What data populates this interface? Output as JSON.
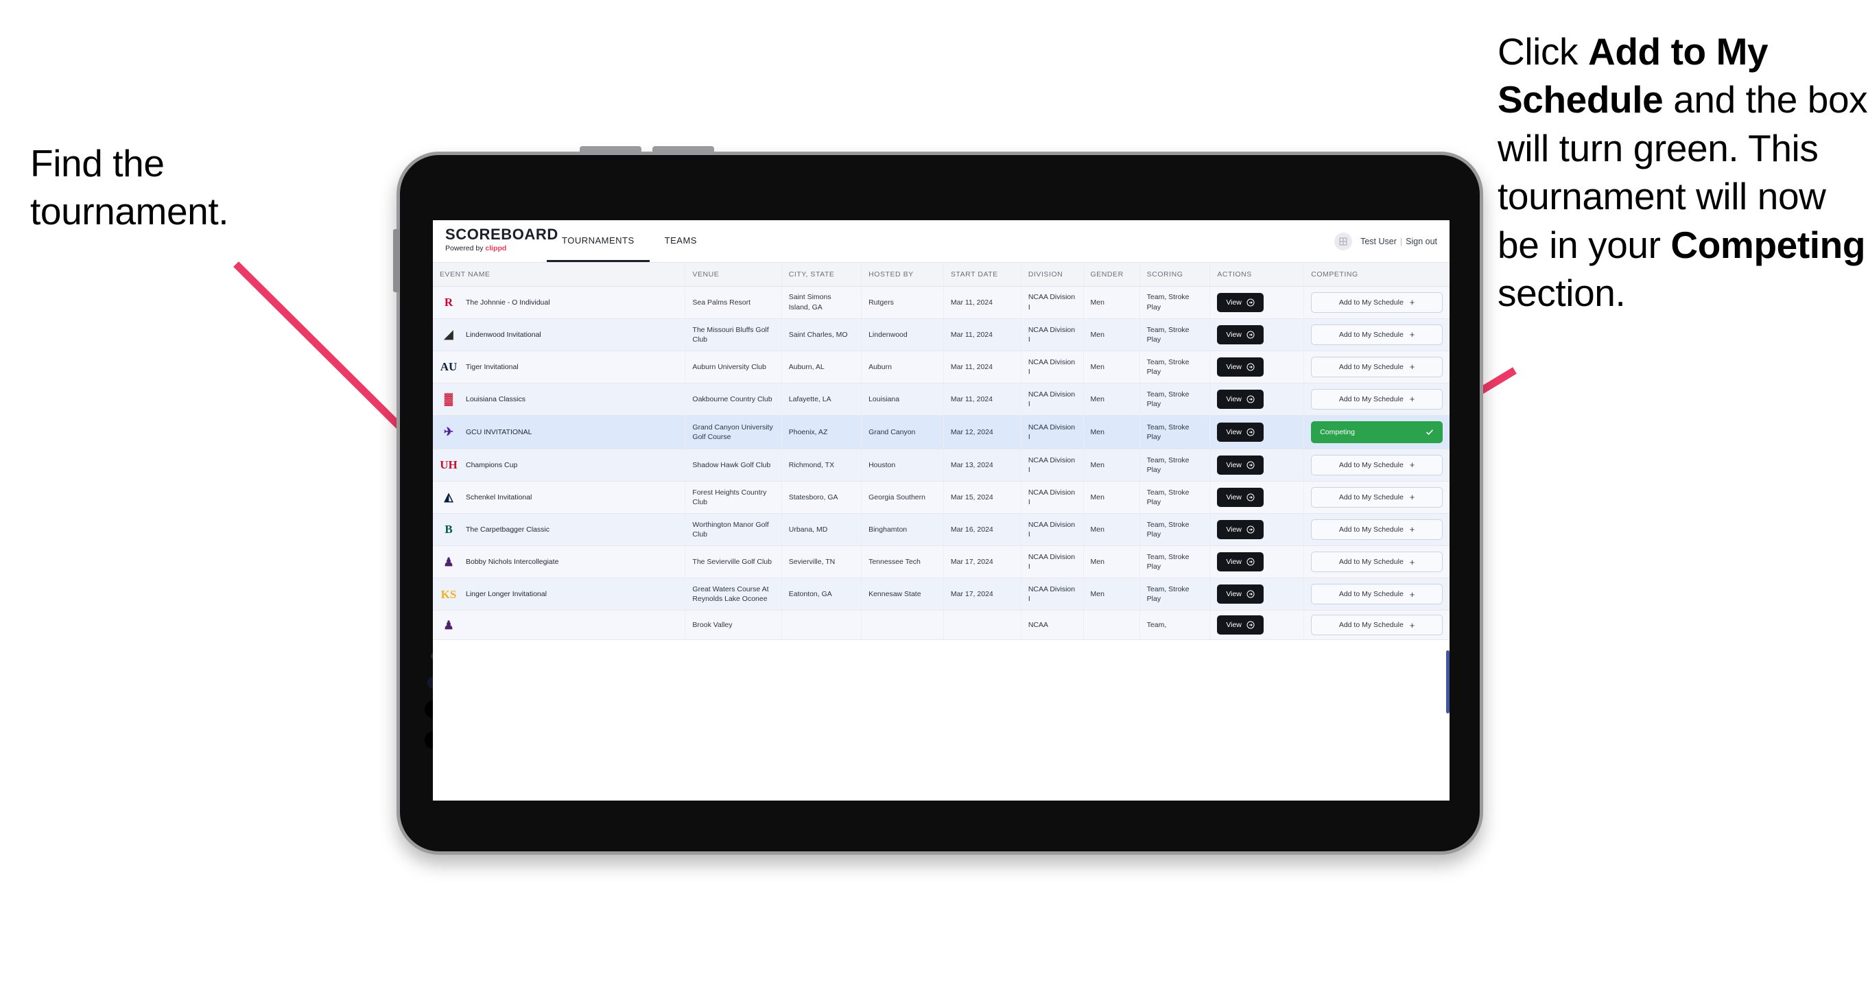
{
  "annotations": {
    "left": "Find the tournament.",
    "right_parts": [
      {
        "text": "Click ",
        "bold": false
      },
      {
        "text": "Add to My Schedule",
        "bold": true
      },
      {
        "text": " and the box will turn green. This tournament will now be in your ",
        "bold": false
      },
      {
        "text": "Competing",
        "bold": true
      },
      {
        "text": " section.",
        "bold": false
      }
    ],
    "arrow_color": "#ec3a66"
  },
  "app": {
    "brand": {
      "title": "SCOREBOARD",
      "powered_prefix": "Powered by ",
      "powered_brand": "clippd"
    },
    "tabs": [
      {
        "label": "TOURNAMENTS",
        "active": true
      },
      {
        "label": "TEAMS",
        "active": false
      }
    ],
    "user": {
      "icon": "grid-avatar-icon",
      "name": "Test User",
      "divider": "|",
      "sign_out": "Sign out"
    },
    "colors": {
      "accent_green": "#2ba24c",
      "brand_pink": "#ef3a5d",
      "dark_button": "#121519",
      "selected_row": "#dde8fb"
    }
  },
  "table": {
    "headers": [
      "EVENT NAME",
      "VENUE",
      "CITY, STATE",
      "HOSTED BY",
      "START DATE",
      "DIVISION",
      "GENDER",
      "SCORING",
      "ACTIONS",
      "COMPETING"
    ],
    "view_label": "View",
    "add_label": "Add to My Schedule",
    "competing_label": "Competing",
    "rows": [
      {
        "logo": "R",
        "logo_color": "#cc0033",
        "event": "The Johnnie - O Individual",
        "venue": "Sea Palms Resort",
        "city": "Saint Simons Island, GA",
        "host": "Rutgers",
        "date": "Mar 11, 2024",
        "division": "NCAA Division I",
        "gender": "Men",
        "scoring": "Team, Stroke Play",
        "competing": false
      },
      {
        "logo": "◢",
        "logo_color": "#2b2a28",
        "event": "Lindenwood Invitational",
        "venue": "The Missouri Bluffs Golf Club",
        "city": "Saint Charles, MO",
        "host": "Lindenwood",
        "date": "Mar 11, 2024",
        "division": "NCAA Division I",
        "gender": "Men",
        "scoring": "Team, Stroke Play",
        "competing": false
      },
      {
        "logo": "AU",
        "logo_color": "#0c2340",
        "event": "Tiger Invitational",
        "venue": "Auburn University Club",
        "city": "Auburn, AL",
        "host": "Auburn",
        "date": "Mar 11, 2024",
        "division": "NCAA Division I",
        "gender": "Men",
        "scoring": "Team, Stroke Play",
        "competing": false
      },
      {
        "logo": "▓",
        "logo_color": "#c8102e",
        "event": "Louisiana Classics",
        "venue": "Oakbourne Country Club",
        "city": "Lafayette, LA",
        "host": "Louisiana",
        "date": "Mar 11, 2024",
        "division": "NCAA Division I",
        "gender": "Men",
        "scoring": "Team, Stroke Play",
        "competing": false
      },
      {
        "logo": "✈",
        "logo_color": "#522398",
        "event": "GCU INVITATIONAL",
        "venue": "Grand Canyon University Golf Course",
        "city": "Phoenix, AZ",
        "host": "Grand Canyon",
        "date": "Mar 12, 2024",
        "division": "NCAA Division I",
        "gender": "Men",
        "scoring": "Team, Stroke Play",
        "competing": true,
        "selected": true
      },
      {
        "logo": "UH",
        "logo_color": "#c8102e",
        "event": "Champions Cup",
        "venue": "Shadow Hawk Golf Club",
        "city": "Richmond, TX",
        "host": "Houston",
        "date": "Mar 13, 2024",
        "division": "NCAA Division I",
        "gender": "Men",
        "scoring": "Team, Stroke Play",
        "competing": false
      },
      {
        "logo": "◭",
        "logo_color": "#041e42",
        "event": "Schenkel Invitational",
        "venue": "Forest Heights Country Club",
        "city": "Statesboro, GA",
        "host": "Georgia Southern",
        "date": "Mar 15, 2024",
        "division": "NCAA Division I",
        "gender": "Men",
        "scoring": "Team, Stroke Play",
        "competing": false
      },
      {
        "logo": "B",
        "logo_color": "#005a43",
        "event": "The Carpetbagger Classic",
        "venue": "Worthington Manor Golf Club",
        "city": "Urbana, MD",
        "host": "Binghamton",
        "date": "Mar 16, 2024",
        "division": "NCAA Division I",
        "gender": "Men",
        "scoring": "Team, Stroke Play",
        "competing": false
      },
      {
        "logo": "♟",
        "logo_color": "#4f2170",
        "event": "Bobby Nichols Intercollegiate",
        "venue": "The Sevierville Golf Club",
        "city": "Sevierville, TN",
        "host": "Tennessee Tech",
        "date": "Mar 17, 2024",
        "division": "NCAA Division I",
        "gender": "Men",
        "scoring": "Team, Stroke Play",
        "competing": false
      },
      {
        "logo": "KS",
        "logo_color": "#f0b323",
        "event": "Linger Longer Invitational",
        "venue": "Great Waters Course At Reynolds Lake Oconee",
        "city": "Eatonton, GA",
        "host": "Kennesaw State",
        "date": "Mar 17, 2024",
        "division": "NCAA Division I",
        "gender": "Men",
        "scoring": "Team, Stroke Play",
        "competing": false
      },
      {
        "logo": "♟",
        "logo_color": "#4f2170",
        "event": "",
        "venue": "Brook Valley",
        "city": "",
        "host": "",
        "date": "",
        "division": "NCAA",
        "gender": "",
        "scoring": "Team,",
        "competing": false,
        "cut": true
      }
    ]
  }
}
